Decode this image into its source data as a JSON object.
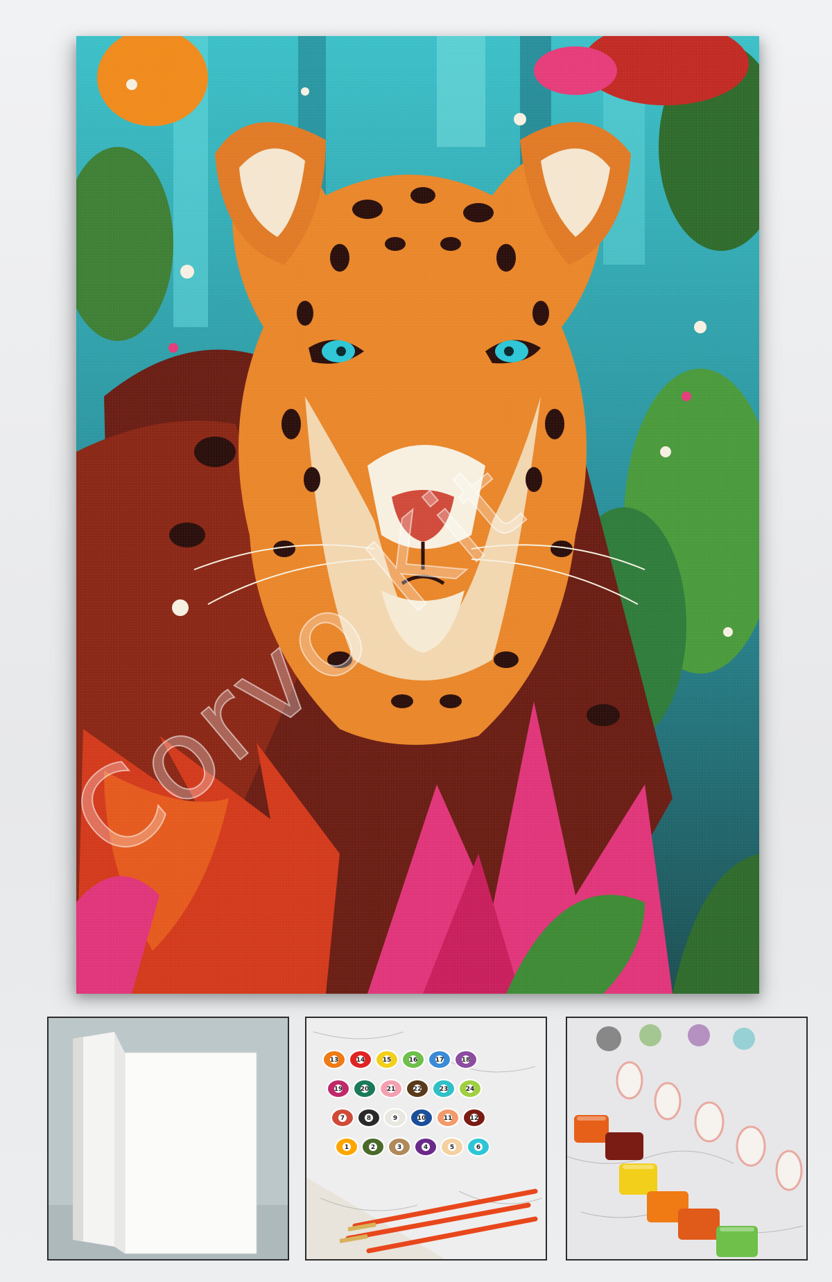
{
  "watermark": {
    "text": "Corvo Kit"
  },
  "thumbnails": [
    {
      "id": "blank-canvas",
      "subject": "blank stretched canvas"
    },
    {
      "id": "numbered-paints",
      "subject": "numbered paint pots with brushes",
      "pot_numbers": [
        "13",
        "14",
        "15",
        "16",
        "17",
        "18",
        "19",
        "20",
        "21",
        "22",
        "23",
        "24",
        "7",
        "8",
        "9",
        "10",
        "11",
        "12",
        "1",
        "2",
        "3",
        "4",
        "5",
        "6"
      ]
    },
    {
      "id": "open-paints",
      "subject": "opened paint pots on outline canvas"
    }
  ],
  "colors": {
    "teal": "#2fb3c0",
    "orange": "#f28a1e",
    "red": "#c8311c",
    "pink": "#e63c7a",
    "green": "#3f8a3a",
    "dark": "#2a0f0c"
  }
}
